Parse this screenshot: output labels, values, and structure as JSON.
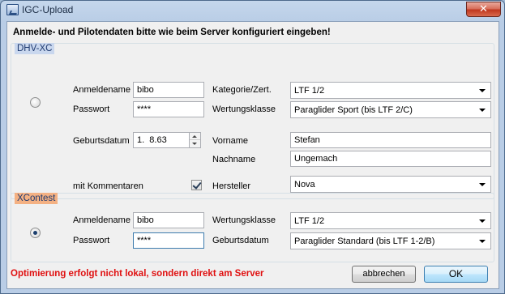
{
  "window": {
    "title": "IGC-Upload",
    "close_glyph": "✕"
  },
  "instruction": "Anmelde- und Pilotendaten bitte wie beim Server konfiguriert eingeben!",
  "dhv": {
    "legend": "DHV-XC",
    "selected": false,
    "login_label": "Anmeldename",
    "login_value": "bibo",
    "password_label": "Passwort",
    "password_value": "****",
    "category_label": "Kategorie/Zert.",
    "category_value": "LTF 1/2",
    "class_label": "Wertungsklasse",
    "class_value": "Paraglider Sport (bis LTF 2/C)",
    "birthdate_label": "Geburtsdatum",
    "birthdate_value": "1.  8.63",
    "firstname_label": "Vorname",
    "firstname_value": "Stefan",
    "lastname_label": "Nachname",
    "lastname_value": "Ungemach",
    "comments_label": "mit Kommentaren",
    "comments_checked": true,
    "manufacturer_label": "Hersteller",
    "manufacturer_value": "Nova"
  },
  "xcontest": {
    "legend": "XContest",
    "selected": true,
    "login_label": "Anmeldename",
    "login_value": "bibo",
    "password_label": "Passwort",
    "password_value": "****",
    "class_label": "Wertungsklasse",
    "class_value": "LTF 1/2",
    "birthdate_label": "Geburtsdatum",
    "birthdate_value": "Paraglider Standard (bis LTF 1-2/B)"
  },
  "footer": {
    "message": "Optimierung erfolgt nicht lokal, sondern direkt am Server",
    "cancel_label": "abbrechen",
    "ok_label": "OK"
  },
  "colors": {
    "error_text": "#e01010",
    "dhv_legend_bg": "#c9d7ee",
    "xc_legend_bg": "#f4b183",
    "title_bar": "#b9cde6"
  }
}
